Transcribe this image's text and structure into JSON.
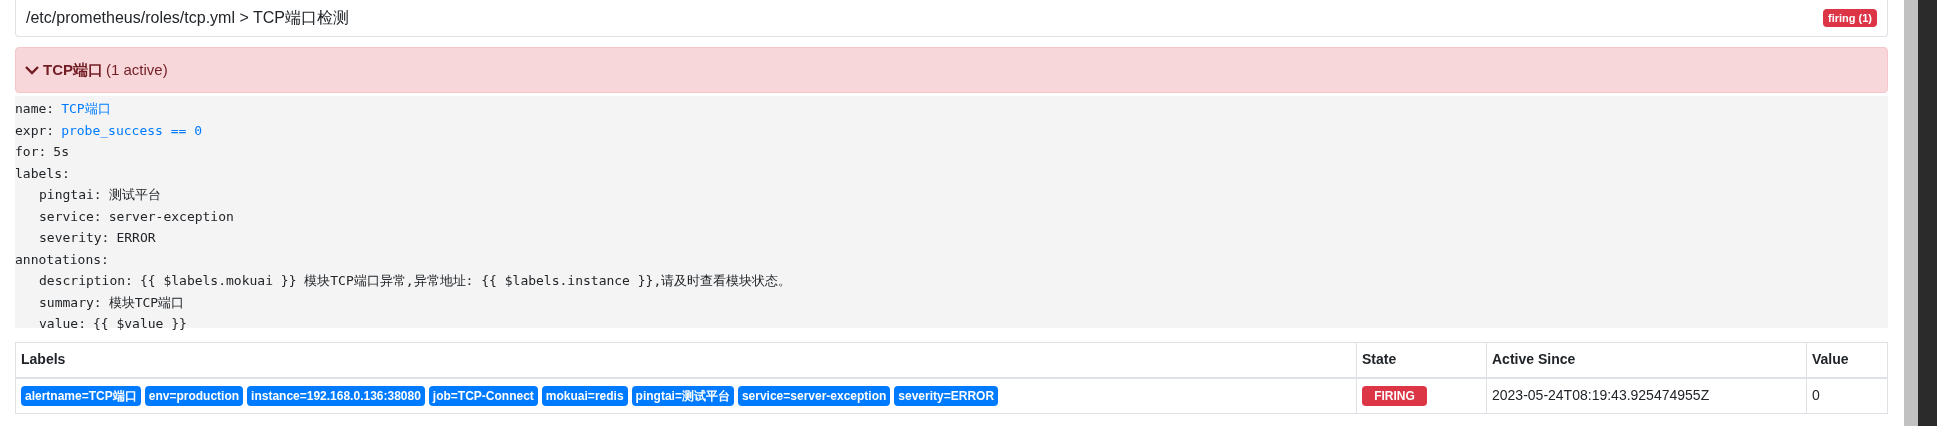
{
  "header": {
    "path": "/etc/prometheus/roles/tcp.yml > TCP端口检测",
    "badge": "firing (1)"
  },
  "group": {
    "title": "TCP端口",
    "count": "(1 active)",
    "expanded": true
  },
  "rule": [
    {
      "key": "name:",
      "value": "TCP端口",
      "kind": "highlight"
    },
    {
      "key": "expr:",
      "value": "probe_success == 0",
      "kind": "highlight"
    },
    {
      "key": "for:",
      "value": "5s",
      "kind": "plain"
    },
    {
      "key": "labels:",
      "kind": "map",
      "children": [
        {
          "key": "pingtai:",
          "value": "测试平台",
          "kind": "plain"
        },
        {
          "key": "service:",
          "value": "server-exception",
          "kind": "plain"
        },
        {
          "key": "severity:",
          "value": "ERROR",
          "kind": "plain"
        }
      ]
    },
    {
      "key": "annotations:",
      "kind": "map",
      "children": [
        {
          "key": "description:",
          "value": "{{ $labels.mokuai }} 模块TCP端口异常,异常地址: {{ $labels.instance }},请及时查看模块状态。",
          "kind": "plain"
        },
        {
          "key": "summary:",
          "value": "模块TCP端口",
          "kind": "plain"
        },
        {
          "key": "value:",
          "value": "{{ $value }}",
          "kind": "plain"
        }
      ]
    }
  ],
  "table": {
    "columns": [
      "Labels",
      "State",
      "Active Since",
      "Value"
    ],
    "rows": [
      {
        "labels": [
          "alertname=TCP端口",
          "env=production",
          "instance=192.168.0.136:38080",
          "job=TCP-Connect",
          "mokuai=redis",
          "pingtai=测试平台",
          "service=server-exception",
          "severity=ERROR"
        ],
        "state": "FIRING",
        "active_since": "2023-05-24T08:19:43.925474955Z",
        "value": "0"
      }
    ]
  }
}
